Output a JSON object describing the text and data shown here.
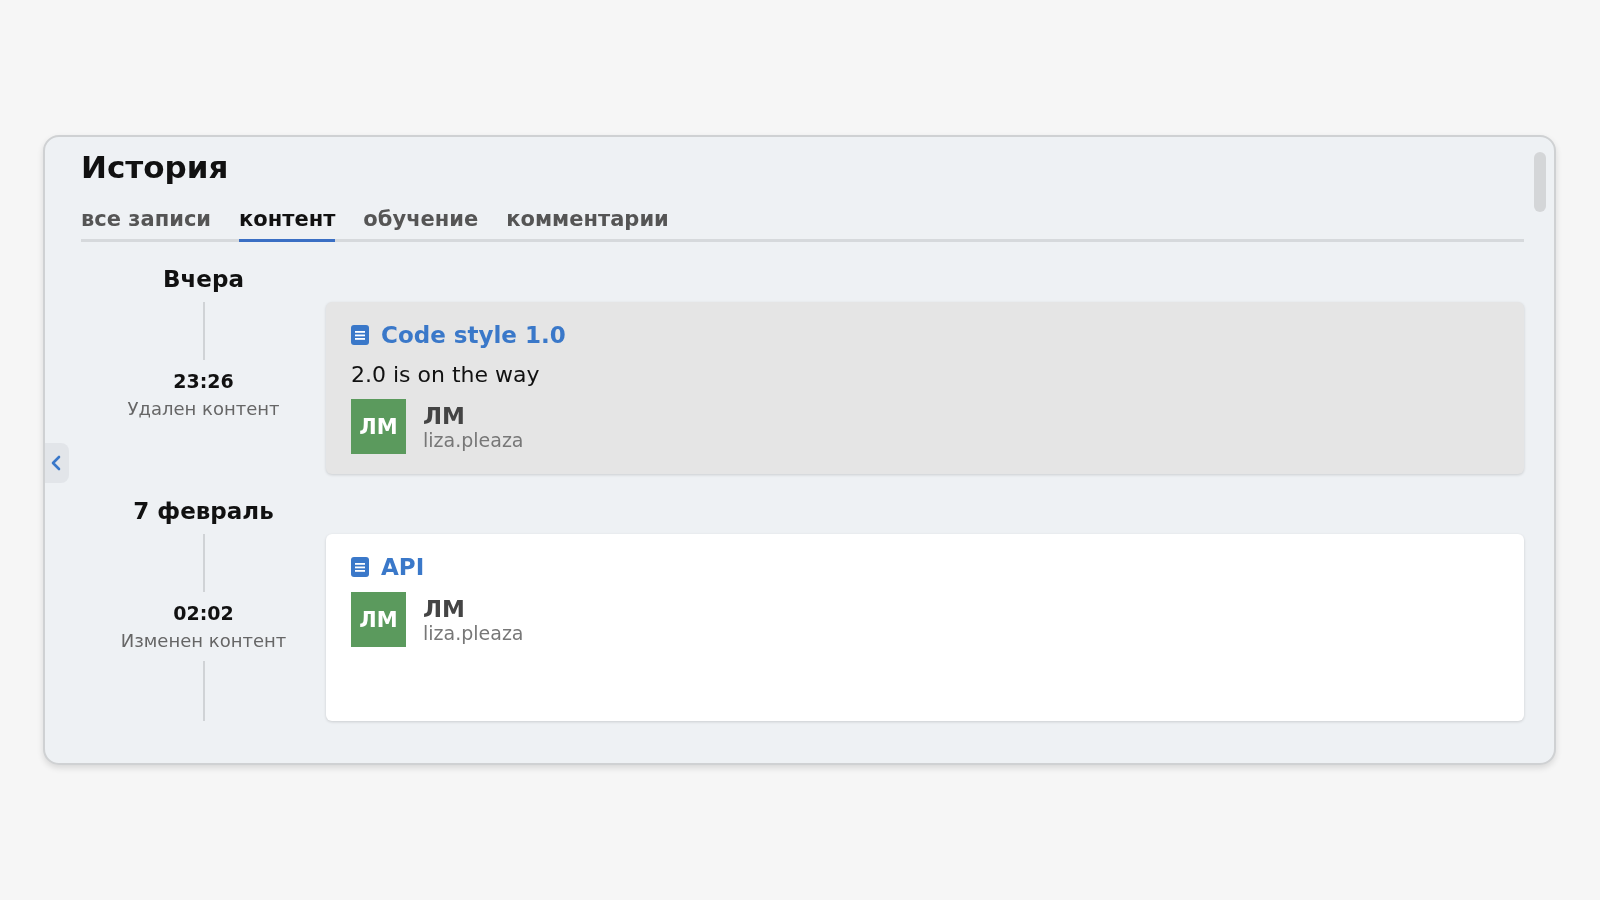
{
  "title": "История",
  "tabs": [
    {
      "label": "все записи",
      "selected": false
    },
    {
      "label": "контент",
      "selected": true
    },
    {
      "label": "обучение",
      "selected": false
    },
    {
      "label": "комментарии",
      "selected": false
    }
  ],
  "groups": [
    {
      "date": "Вчера",
      "entries": [
        {
          "time": "23:26",
          "action": "Удален контент",
          "card": {
            "title": "Code style 1.0",
            "text": "2.0 is on the way",
            "initials": "ЛМ",
            "author": "ЛМ",
            "login": "liza.pleaza",
            "highlighted": true
          }
        }
      ]
    },
    {
      "date": "7 февраль",
      "entries": [
        {
          "time": "02:02",
          "action": "Изменен контент",
          "card": {
            "title": "API",
            "initials": "ЛМ",
            "author": "ЛМ",
            "login": "liza.pleaza",
            "highlighted": false
          }
        }
      ]
    }
  ]
}
